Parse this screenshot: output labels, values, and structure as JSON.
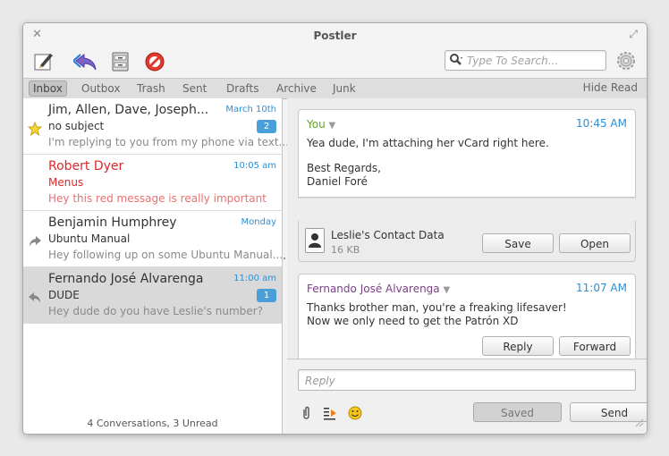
{
  "window": {
    "title": "Postler"
  },
  "search": {
    "placeholder": "Type To Search..."
  },
  "tabs": [
    {
      "label": "Inbox",
      "active": true
    },
    {
      "label": "Outbox"
    },
    {
      "label": "Trash"
    },
    {
      "label": "Sent"
    },
    {
      "label": "Drafts"
    },
    {
      "label": "Archive"
    },
    {
      "label": "Junk"
    }
  ],
  "hide_read_label": "Hide Read",
  "conversations": [
    {
      "from": "Jim, Allen, Dave, Joseph...",
      "time": "March 10th",
      "subject": "no subject",
      "preview": "I'm replying to you from my phone via text...",
      "badge": "2",
      "marker": "star-icon"
    },
    {
      "from": "Robert Dyer",
      "time": "10:05 am",
      "subject": "Menus",
      "preview": "Hey this red message is really important",
      "color": "#e0282a"
    },
    {
      "from": "Benjamin Humphrey",
      "time": "Monday",
      "subject": "Ubuntu Manual",
      "preview": "Hey following up on some Ubuntu Manual...",
      "marker": "forward-arrow-icon"
    },
    {
      "from": "Fernando José Alvarenga",
      "time": "11:00 am",
      "subject": "DUDE",
      "preview": "Hey dude do you have Leslie's number?",
      "badge": "1",
      "marker": "reply-arrow-icon",
      "selected": true
    }
  ],
  "list_status": "4 Conversations, 3 Unread",
  "messages": [
    {
      "sender": "You",
      "time": "10:45 AM",
      "body": [
        "Yea dude, I'm attaching her vCard right here."
      ],
      "signature": [
        "Best Regards,",
        "Daniel Foré"
      ],
      "attachment": {
        "name": "Leslie's Contact Data",
        "size": "16 KB",
        "save_label": "Save",
        "open_label": "Open"
      }
    },
    {
      "sender": "Fernando José Alvarenga",
      "time": "11:07 AM",
      "body": [
        "Thanks brother man, you're a freaking lifesaver!",
        "Now we only need to get the Patrón XD"
      ],
      "reply_label": "Reply",
      "forward_label": "Forward"
    }
  ],
  "compose": {
    "placeholder": "Reply",
    "saved_label": "Saved",
    "send_label": "Send"
  },
  "colors": {
    "accent": "#2a8fd6",
    "important": "#e0282a",
    "badge": "#4a9fd9",
    "you": "#5fa226",
    "sender": "#7b3f86"
  }
}
